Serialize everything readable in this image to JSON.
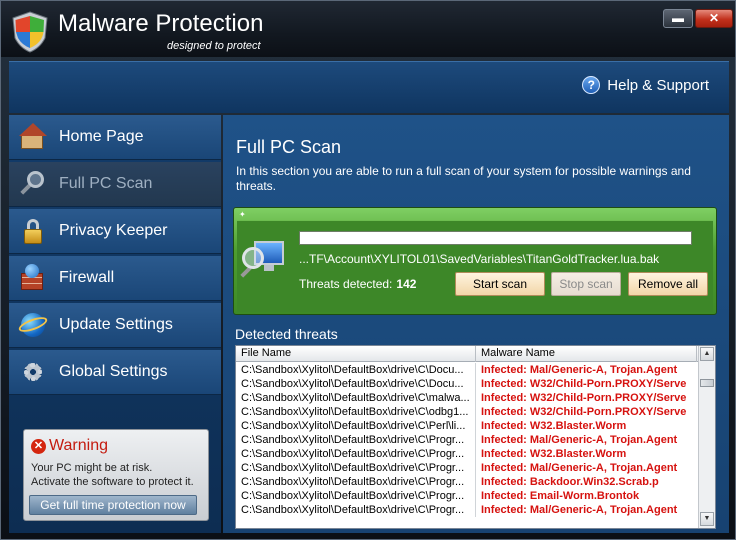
{
  "window": {
    "title": "Malware Protection",
    "subtitle": "designed to protect",
    "minimize_label": "▬",
    "close_label": "✕"
  },
  "header": {
    "help_label": "Help & Support",
    "help_icon_glyph": "?"
  },
  "sidebar": {
    "items": [
      {
        "label": "Home Page",
        "icon": "house-icon"
      },
      {
        "label": "Full PC Scan",
        "icon": "magnifier-icon",
        "active": true
      },
      {
        "label": "Privacy Keeper",
        "icon": "padlock-icon"
      },
      {
        "label": "Firewall",
        "icon": "firewall-icon"
      },
      {
        "label": "Update Settings",
        "icon": "globe-update-icon"
      },
      {
        "label": "Global Settings",
        "icon": "gear-icon"
      }
    ]
  },
  "warning": {
    "title": "Warning",
    "line1": "Your PC might be at risk.",
    "line2": "Activate the software to protect it.",
    "button_label": "Get full time protection now"
  },
  "main": {
    "title": "Full PC Scan",
    "description": "In this section you are able to run a full scan of your system for possible warnings and threats.",
    "scan": {
      "current_path": "...TF\\Account\\XYLITOL01\\SavedVariables\\TitanGoldTracker.lua.bak",
      "threats_label": "Threats detected:",
      "threats_count": "142",
      "start_label": "Start scan",
      "stop_label": "Stop scan",
      "remove_label": "Remove all"
    },
    "threats": {
      "title": "Detected threats",
      "columns": [
        "File Name",
        "Malware Name"
      ],
      "rows": [
        [
          "C:\\Sandbox\\Xylitol\\DefaultBox\\drive\\C\\Docu...",
          "Infected: Mal/Generic-A, Trojan.Agent"
        ],
        [
          "C:\\Sandbox\\Xylitol\\DefaultBox\\drive\\C\\Docu...",
          "Infected: W32/Child-Porn.PROXY/Serve"
        ],
        [
          "C:\\Sandbox\\Xylitol\\DefaultBox\\drive\\C\\malwa...",
          "Infected: W32/Child-Porn.PROXY/Serve"
        ],
        [
          "C:\\Sandbox\\Xylitol\\DefaultBox\\drive\\C\\odbg1...",
          "Infected: W32/Child-Porn.PROXY/Serve"
        ],
        [
          "C:\\Sandbox\\Xylitol\\DefaultBox\\drive\\C\\Perl\\li...",
          "Infected: W32.Blaster.Worm"
        ],
        [
          "C:\\Sandbox\\Xylitol\\DefaultBox\\drive\\C\\Progr...",
          "Infected: Mal/Generic-A, Trojan.Agent"
        ],
        [
          "C:\\Sandbox\\Xylitol\\DefaultBox\\drive\\C\\Progr...",
          "Infected: W32.Blaster.Worm"
        ],
        [
          "C:\\Sandbox\\Xylitol\\DefaultBox\\drive\\C\\Progr...",
          "Infected: Mal/Generic-A, Trojan.Agent"
        ],
        [
          "C:\\Sandbox\\Xylitol\\DefaultBox\\drive\\C\\Progr...",
          "Infected: Backdoor.Win32.Scrab.p"
        ],
        [
          "C:\\Sandbox\\Xylitol\\DefaultBox\\drive\\C\\Progr...",
          "Infected: Email-Worm.Brontok"
        ],
        [
          "C:\\Sandbox\\Xylitol\\DefaultBox\\drive\\C\\Progr...",
          "Infected: Mal/Generic-A, Trojan.Agent"
        ]
      ]
    }
  },
  "colors": {
    "threat_text": "#d6120f",
    "accent_green": "#4e9e31",
    "warning_red": "#c41b0f"
  }
}
